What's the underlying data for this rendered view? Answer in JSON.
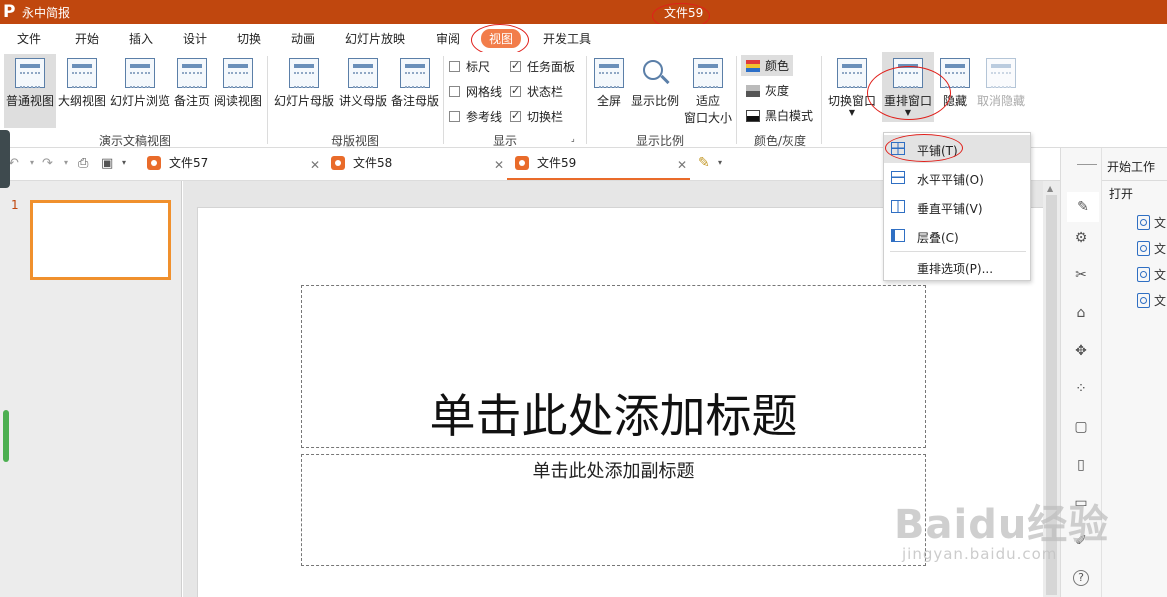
{
  "app": {
    "name": "永中简报",
    "doc_title": "文件59"
  },
  "menu": [
    "文件",
    "开始",
    "插入",
    "设计",
    "切换",
    "动画",
    "幻灯片放映",
    "审阅",
    "视图",
    "开发工具"
  ],
  "ribbon": {
    "presentation_views": {
      "label": "演示文稿视图",
      "items": [
        "普通视图",
        "大纲视图",
        "幻灯片浏览",
        "备注页",
        "阅读视图"
      ]
    },
    "master_views": {
      "label": "母版视图",
      "items": [
        "幻灯片母版",
        "讲义母版",
        "备注母版"
      ]
    },
    "show": {
      "label": "显示",
      "items": [
        "标尺",
        "网格线",
        "参考线",
        "任务面板",
        "状态栏",
        "切换栏"
      ]
    },
    "zoom": {
      "label": "显示比例",
      "items": [
        "全屏",
        "显示比例"
      ],
      "fit_line1": "适应",
      "fit_line2": "窗口大小"
    },
    "color": {
      "label": "颜色/灰度",
      "items": [
        "颜色",
        "灰度",
        "黑白模式"
      ]
    },
    "window": {
      "items": [
        "切换窗口",
        "重排窗口",
        "隐藏",
        "取消隐藏"
      ]
    }
  },
  "tabs": [
    "文件57",
    "文件58",
    "文件59"
  ],
  "slide": {
    "number": "1",
    "title_placeholder": "单击此处添加标题",
    "subtitle_placeholder": "单击此处添加副标题"
  },
  "arrange_menu": {
    "items": [
      "平铺(T)",
      "水平平铺(O)",
      "垂直平铺(V)",
      "层叠(C)",
      "重排选项(P)..."
    ]
  },
  "task_pane": {
    "title": "开始工作",
    "open_label": "打开",
    "files": [
      "文",
      "文",
      "文",
      "文"
    ]
  },
  "watermark": {
    "brand": "Baidu经验",
    "url": "jingyan.baidu.com"
  },
  "colors": {
    "title_bar": "#c0470e",
    "active_menu": "#f27d4a",
    "accent_orange": "#e96b2a",
    "annotation_red": "#e0201b"
  }
}
